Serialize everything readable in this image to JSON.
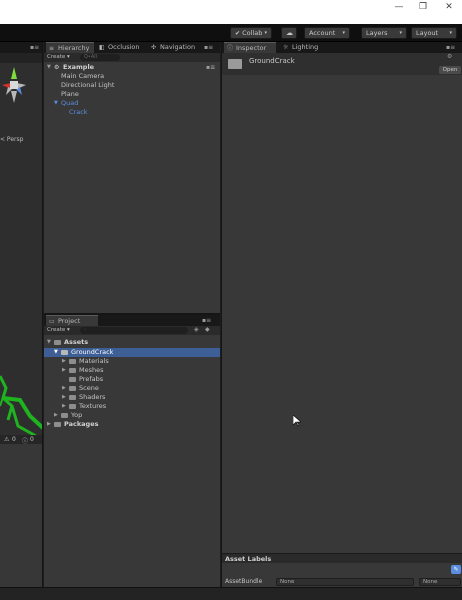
{
  "window": {
    "minimize_glyph": "—",
    "maximize_glyph": "❐",
    "close_glyph": "✕"
  },
  "toolbar": {
    "collab_label": "Collab",
    "account_label": "Account",
    "layers_label": "Layers",
    "layout_label": "Layout",
    "caret": "▾"
  },
  "scene": {
    "persp_label": "< Persp",
    "stat_1": "0",
    "stat_2": "0"
  },
  "hierarchy": {
    "tabs": [
      "Hierarchy",
      "Occlusion",
      "Navigation"
    ],
    "create_label": "Create",
    "search_placeholder": "Q•All",
    "scene_name": "Example",
    "items": [
      "Main Camera",
      "Directional Light",
      "Plane",
      "Quad",
      "Crack"
    ]
  },
  "project": {
    "tab_label": "Project",
    "create_label": "Create",
    "tree": {
      "assets": "Assets",
      "groundcrack": "GroundCrack",
      "children": [
        "Materials",
        "Meshes",
        "Prefabs",
        "Scene",
        "Shaders",
        "Textures"
      ],
      "yop": "Yop",
      "packages": "Packages"
    }
  },
  "inspector": {
    "tabs": [
      "Inspector",
      "Lighting"
    ],
    "asset_name": "GroundCrack",
    "open_label": "Open",
    "asset_labels_title": "Asset Labels",
    "asset_bundle_label": "AssetBundle",
    "bundle_value": "None",
    "variant_value": "None"
  },
  "colors": {
    "selection": "#3d5f96",
    "link_blue": "#5b8ee0",
    "panel_bg": "#383838",
    "gizmo_green": "#7fdc3c",
    "gizmo_red": "#d0342c",
    "mesh_green": "#1fb31f"
  }
}
